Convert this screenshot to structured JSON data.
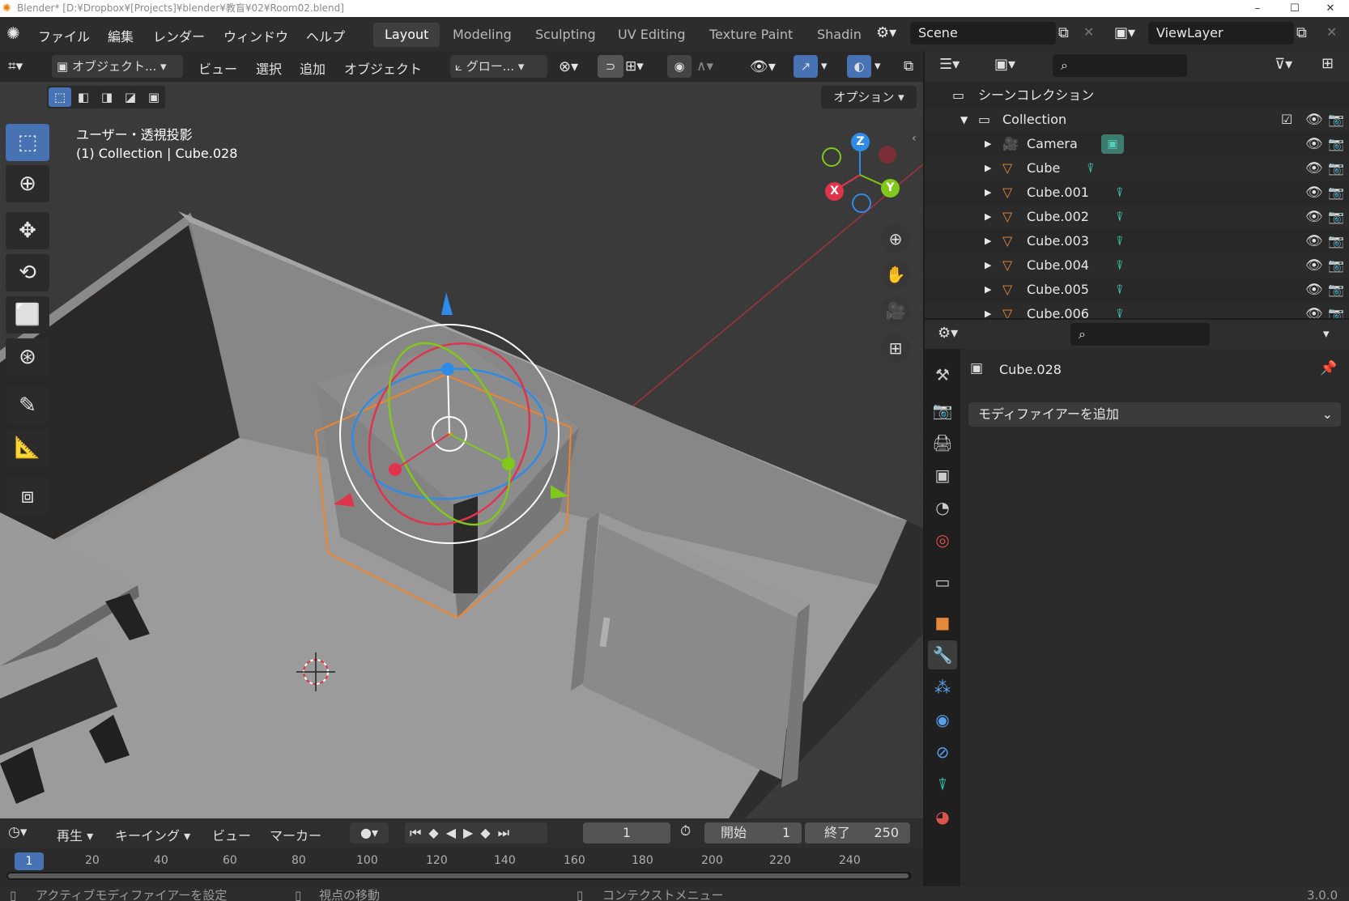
{
  "titlebar": {
    "title": "Blender* [D:¥Dropbox¥[Projects]¥blender¥教盲¥02¥Room02.blend]",
    "minimize": "–",
    "maximize": "☐",
    "close": "✕"
  },
  "menu": {
    "items": [
      "ファイル",
      "編集",
      "レンダー",
      "ウィンドウ",
      "ヘルプ"
    ]
  },
  "workspaces": {
    "tabs": [
      "Layout",
      "Modeling",
      "Sculpting",
      "UV Editing",
      "Texture Paint",
      "Shadin"
    ],
    "active": "Layout"
  },
  "scene": {
    "name": "Scene"
  },
  "view_layer": {
    "name": "ViewLayer"
  },
  "viewport": {
    "mode": "オブジェクト...",
    "menus": [
      "ビュー",
      "選択",
      "追加",
      "オブジェクト"
    ],
    "transform_orientation": "グロー...",
    "options_label": "オプション",
    "view_name": "ユーザー・透視投影",
    "active_info": "(1) Collection | Cube.028",
    "gizmo_axes": {
      "x": "X",
      "y": "Y",
      "z": "Z"
    },
    "colors": {
      "x_axis": "#e0344d",
      "y_axis": "#82c81a",
      "z_axis": "#2f8be8",
      "selection": "#f0842a"
    }
  },
  "outliner": {
    "search_placeholder": "",
    "scene_collection": "シーンコレクション",
    "collection": "Collection",
    "items": [
      {
        "name": "Camera",
        "type": "camera"
      },
      {
        "name": "Cube",
        "type": "mesh"
      },
      {
        "name": "Cube.001",
        "type": "mesh"
      },
      {
        "name": "Cube.002",
        "type": "mesh"
      },
      {
        "name": "Cube.003",
        "type": "mesh"
      },
      {
        "name": "Cube.004",
        "type": "mesh"
      },
      {
        "name": "Cube.005",
        "type": "mesh"
      },
      {
        "name": "Cube.006",
        "type": "mesh"
      }
    ]
  },
  "properties": {
    "search_placeholder": "",
    "object_name": "Cube.028",
    "add_modifier": "モディファイアーを追加"
  },
  "timeline": {
    "playback": "再生",
    "keying": "キーイング",
    "view": "ビュー",
    "marker": "マーカー",
    "current_frame": "1",
    "start_label": "開始",
    "start": "1",
    "end_label": "終了",
    "end": "250",
    "ruler": [
      "1",
      "20",
      "40",
      "60",
      "80",
      "100",
      "120",
      "140",
      "160",
      "180",
      "200",
      "220",
      "240"
    ]
  },
  "statusbar": {
    "hint1": "アクティブモディファイアーを設定",
    "hint2": "視点の移動",
    "hint3": "コンテクストメニュー",
    "version": "3.0.0"
  }
}
